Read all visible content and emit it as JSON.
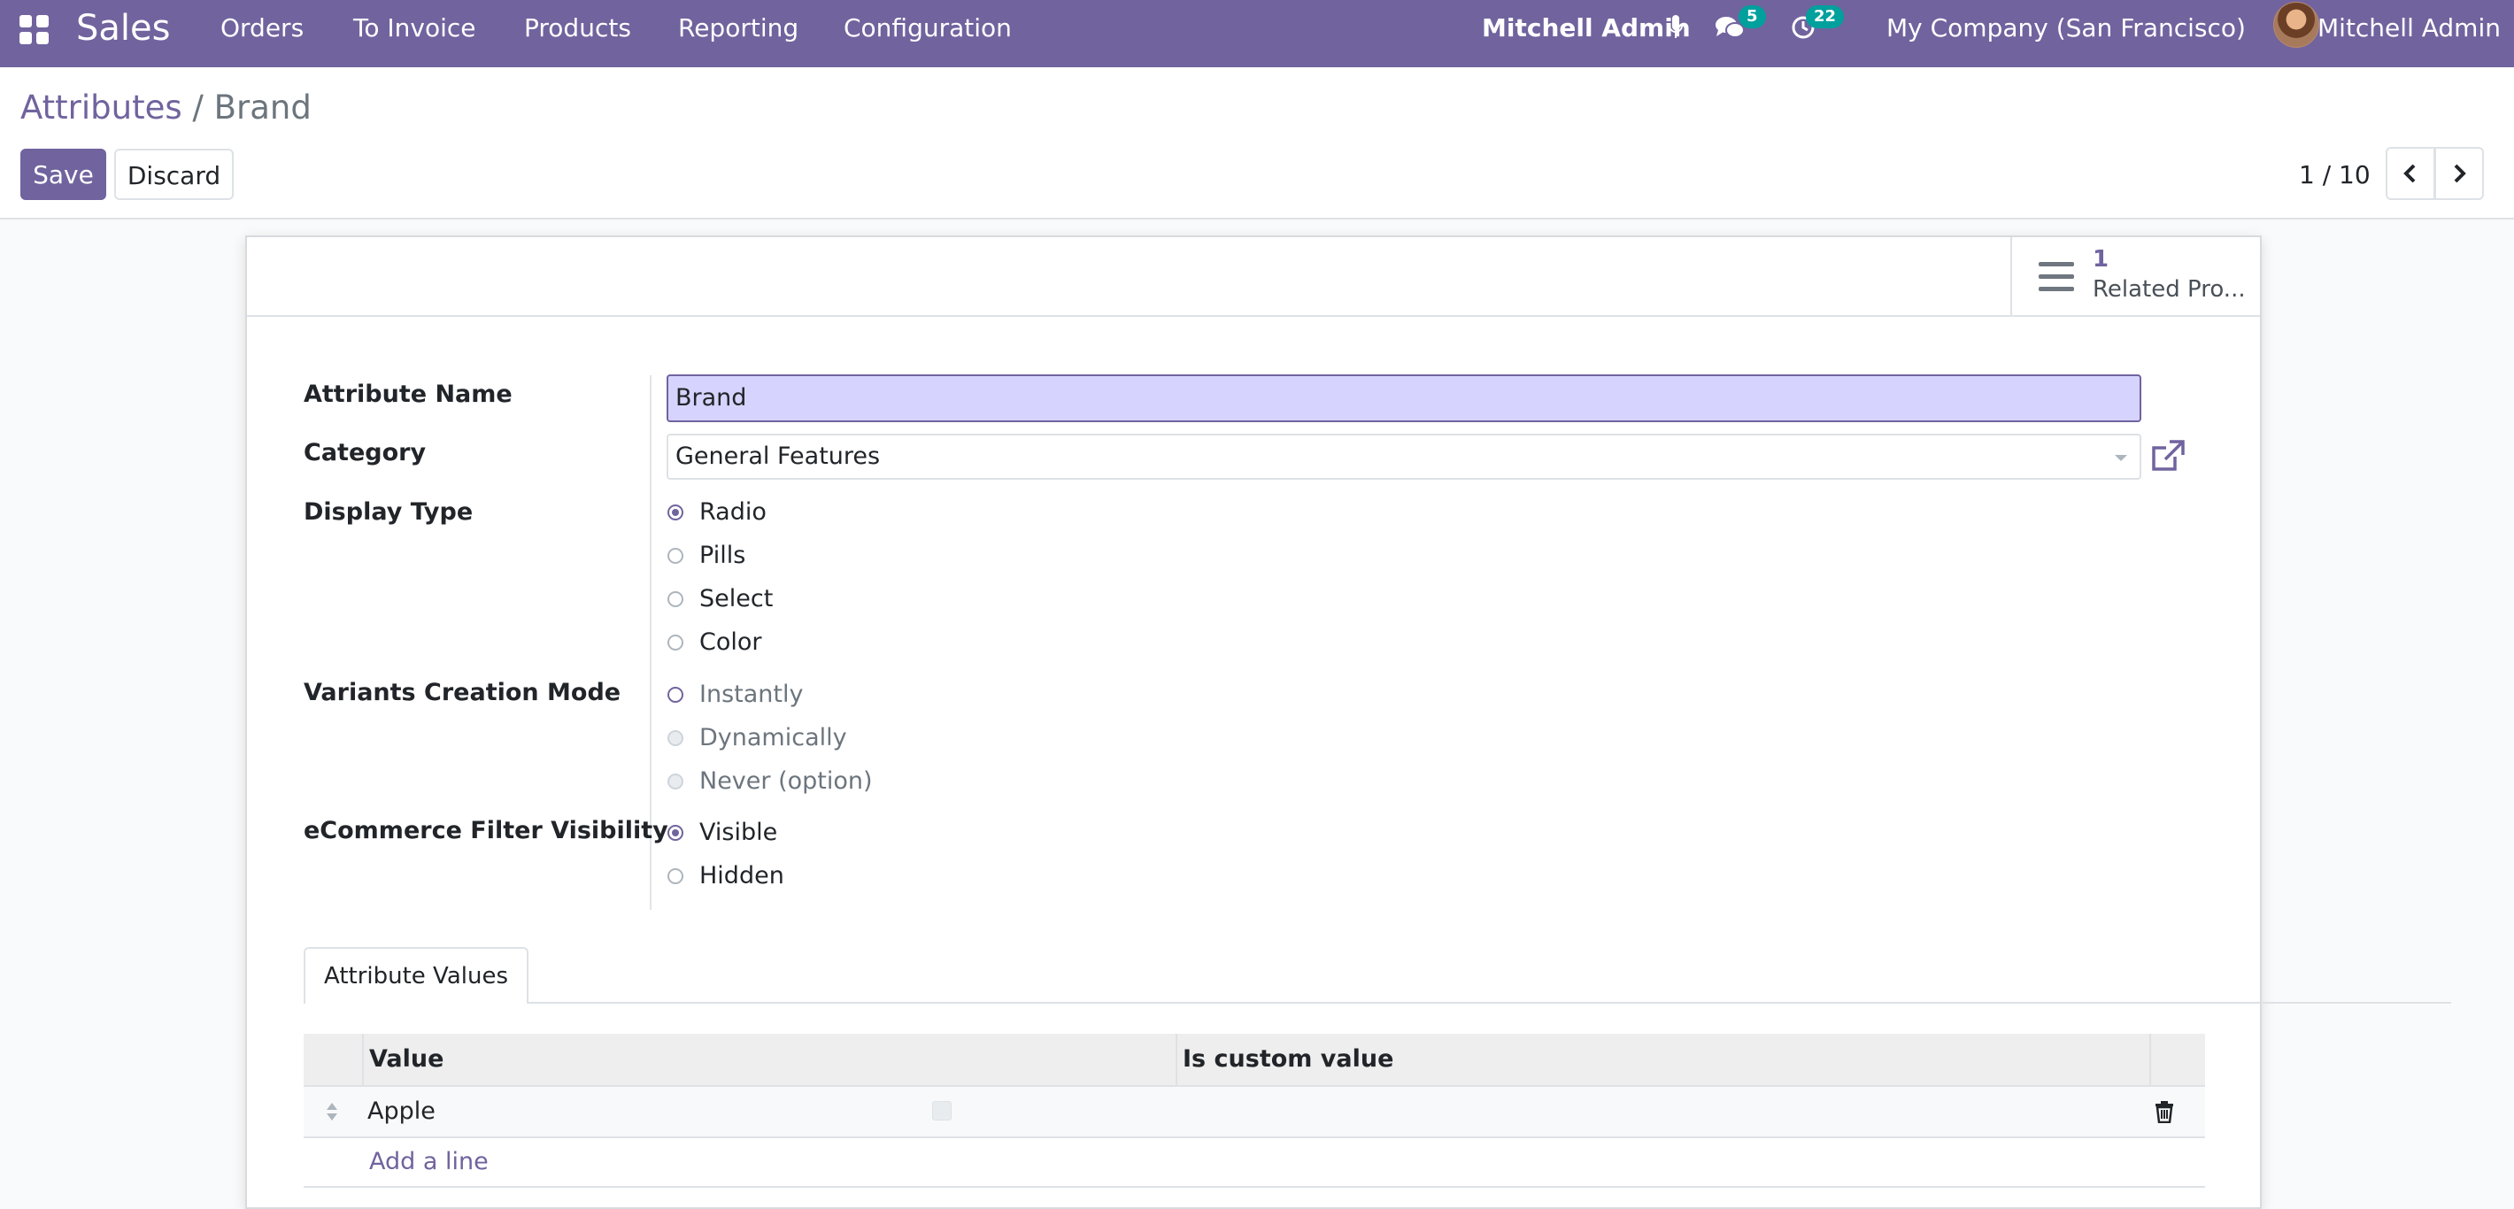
{
  "navbar": {
    "app_name": "Sales",
    "menu": [
      "Orders",
      "To Invoice",
      "Products",
      "Reporting",
      "Configuration"
    ],
    "user_bold": "Mitchell Admin",
    "messages_count": "5",
    "activities_count": "22",
    "company": "My Company (San Francisco)",
    "user_name": "Mitchell Admin",
    "accent_color": "#71639e"
  },
  "breadcrumb": {
    "parent": "Attributes",
    "separator": "/",
    "current": "Brand"
  },
  "actions": {
    "save_label": "Save",
    "discard_label": "Discard"
  },
  "pager": {
    "value": "1 / 10"
  },
  "stat_button": {
    "value": "1",
    "label": "Related Pro..."
  },
  "form": {
    "attribute_name_label": "Attribute Name",
    "attribute_name_value": "Brand",
    "category_label": "Category",
    "category_value": "General Features",
    "display_type_label": "Display Type",
    "display_type_options": [
      "Radio",
      "Pills",
      "Select",
      "Color"
    ],
    "display_type_selected": "Radio",
    "variants_label": "Variants Creation Mode",
    "variants_options": [
      "Instantly",
      "Dynamically",
      "Never (option)"
    ],
    "ecommerce_label": "eCommerce Filter Visibility",
    "ecommerce_options": [
      "Visible",
      "Hidden"
    ],
    "ecommerce_selected": "Visible"
  },
  "notebook": {
    "tab_label": "Attribute Values",
    "columns": [
      "Value",
      "Is custom value"
    ],
    "rows": [
      {
        "value": "Apple",
        "is_custom": false
      }
    ],
    "add_line_label": "Add a line"
  }
}
